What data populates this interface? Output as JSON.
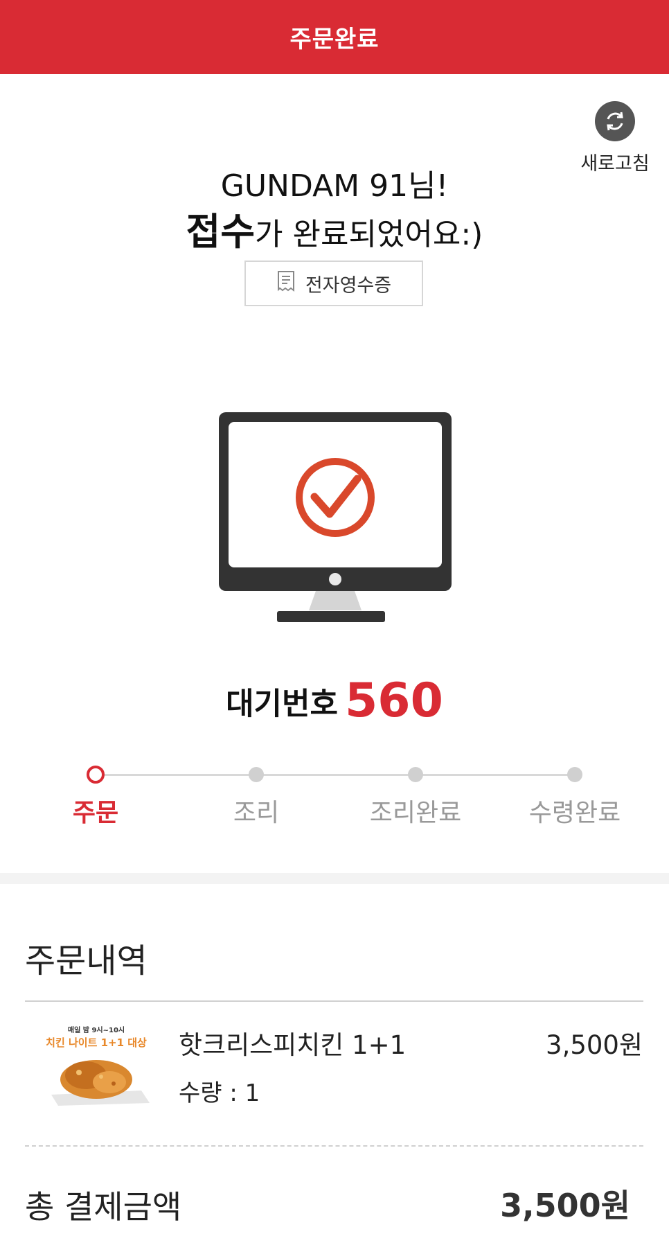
{
  "header": {
    "title": "주문완료"
  },
  "refresh": {
    "label": "새로고침",
    "icon": "refresh-icon"
  },
  "greeting": {
    "name_line": "GUNDAM 91님!",
    "emphasis": "접수",
    "message_rest": "가 완료되었어요:)"
  },
  "receipt_button": {
    "label": "전자영수증",
    "icon": "receipt-icon"
  },
  "status_illustration": {
    "icon": "monitor-check-icon",
    "accent": "#d9482b"
  },
  "waiting": {
    "label": "대기번호",
    "number": "560"
  },
  "steps": [
    {
      "label": "주문",
      "active": true
    },
    {
      "label": "조리",
      "active": false
    },
    {
      "label": "조리완료",
      "active": false
    },
    {
      "label": "수령완료",
      "active": false
    }
  ],
  "order": {
    "section_title": "주문내역",
    "items": [
      {
        "thumb_line1": "매일 밤 9시~10시",
        "thumb_line2": "치킨 나이트 1+1 대상",
        "name": "핫크리스피치킨 1+1",
        "price": "3,500원",
        "qty_label": "수량 : 1"
      }
    ],
    "total_label": "총 결제금액",
    "total_value": "3,500원"
  },
  "colors": {
    "brand_red": "#d92b34",
    "muted": "#999999"
  }
}
